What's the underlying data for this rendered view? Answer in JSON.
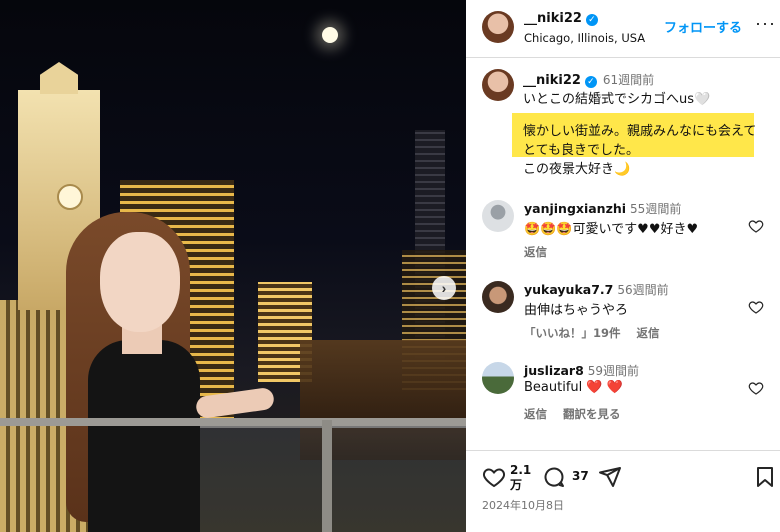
{
  "post": {
    "carousel_next_icon": "chevron-right-icon"
  },
  "header": {
    "username": "__niki22",
    "location": "Chicago, Illinois, USA",
    "follow_label": "フォローする",
    "more_label": "···"
  },
  "caption": {
    "username": "__niki22",
    "time": "61週間前",
    "line1": "いとこの結婚式でシカゴへus🤍",
    "line2": "懐かしい街並み。親戚みんなにも会えてとても良きでした。",
    "line3": "この夜景大好き🌙",
    "highlight_color": "#ffe74a"
  },
  "comments": [
    {
      "username": "yanjingxianzhi",
      "time": "55週間前",
      "text": "🤩🤩🤩可愛いです♥♥好き♥",
      "actions": [
        "返信"
      ]
    },
    {
      "username": "yukayuka7.7",
      "time": "56週間前",
      "text": "由伸はちゃうやろ",
      "actions": [
        "「いいね！」19件",
        "返信"
      ]
    },
    {
      "username": "juslizar8",
      "time": "59週間前",
      "text": "Beautiful ❤️ ❤️",
      "actions": [
        "返信",
        "翻訳を見る"
      ]
    }
  ],
  "footer": {
    "likes": "2.1",
    "likes_unit": "万",
    "comments": "37",
    "date": "2024年10月8日"
  },
  "colors": {
    "accent": "#0095f6",
    "verified": "#0095f6",
    "like_red": "#ff3040"
  }
}
